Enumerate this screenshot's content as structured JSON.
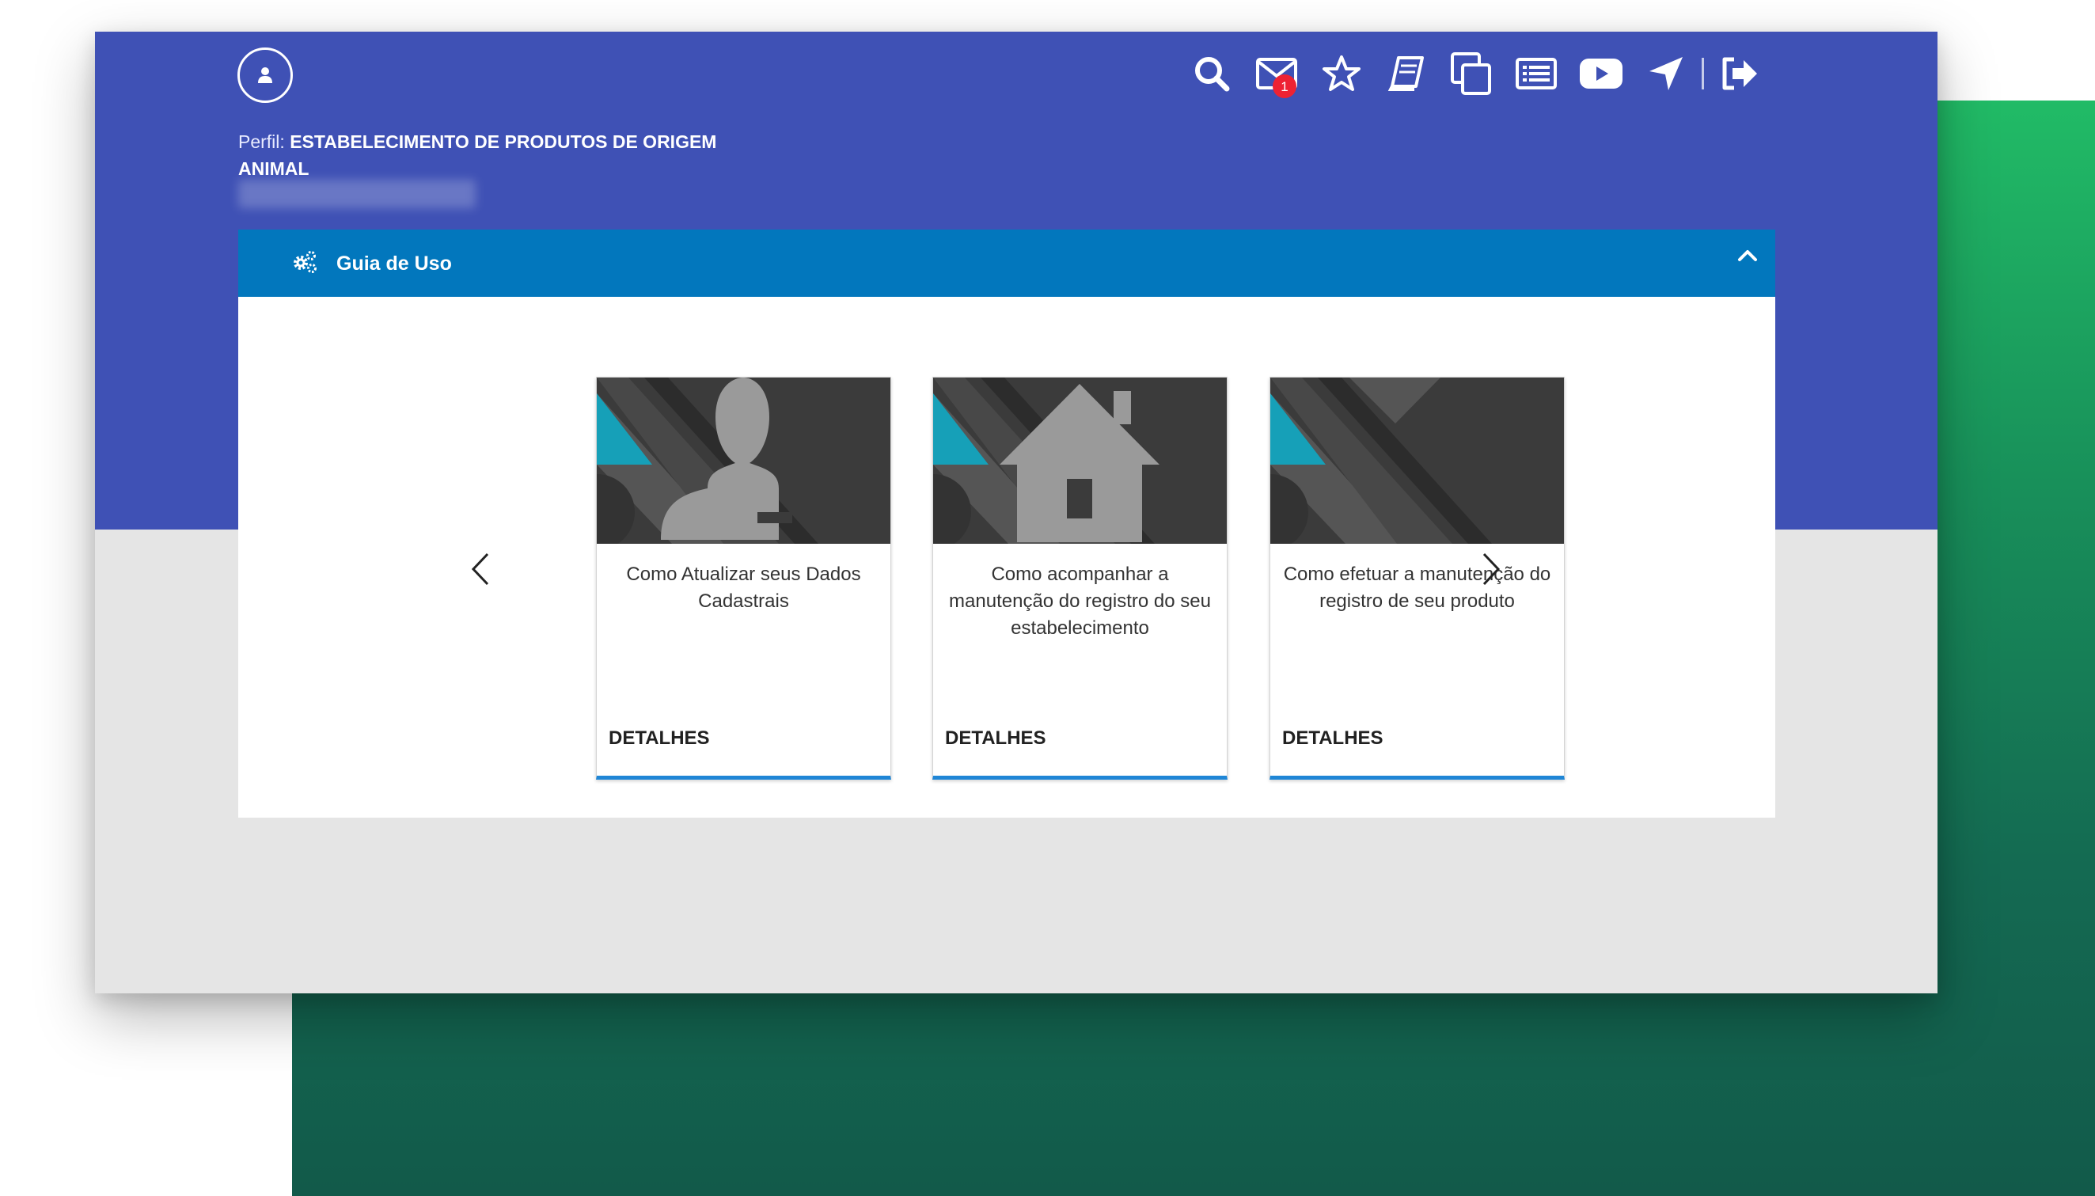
{
  "header": {
    "profile_label": "Perfil:",
    "profile_value": "ESTABELECIMENTO DE PRODUTOS DE ORIGEM ANIMAL",
    "mail_badge": "1"
  },
  "toolbar": {
    "icons": [
      "search-icon",
      "mail-icon",
      "star-icon",
      "book-icon",
      "copy-icon",
      "list-icon",
      "youtube-icon",
      "navigation-icon",
      "logout-icon"
    ]
  },
  "panel": {
    "title": "Guia de Uso"
  },
  "cards": [
    {
      "title": "Como Atualizar seus Dados Cadastrais",
      "link": "DETALHES",
      "icon": "person-icon"
    },
    {
      "title": "Como acompanhar a manutenção do registro do seu estabelecimento",
      "link": "DETALHES",
      "icon": "house-icon"
    },
    {
      "title": "Como efetuar a manutenção do registro de seu produto",
      "link": "DETALHES",
      "icon": "none"
    }
  ],
  "colors": {
    "header": "#3f51b5",
    "panel_header": "#0277bd",
    "card_accent": "#1f86d6",
    "badge": "#ee2233",
    "green_gradient_top": "#21bb66",
    "green_gradient_bottom": "#125a4a"
  }
}
